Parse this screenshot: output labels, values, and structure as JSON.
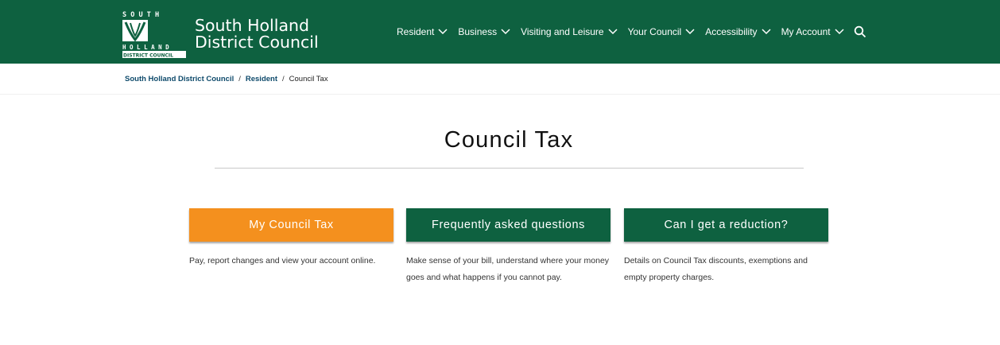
{
  "header": {
    "bg_color": "#0e6140",
    "logo": {
      "line1": "South Holland",
      "line2": "District Council",
      "mark_top": "S O U T H",
      "mark_mid": "H O L L A N D",
      "mark_bottom": "DISTRICT COUNCIL"
    },
    "nav": [
      {
        "label": "Resident",
        "icon": "chevron-down-icon"
      },
      {
        "label": "Business",
        "icon": "chevron-down-icon"
      },
      {
        "label": "Visiting and Leisure",
        "icon": "chevron-down-icon"
      },
      {
        "label": "Your Council",
        "icon": "chevron-down-icon"
      },
      {
        "label": "Accessibility",
        "icon": "chevron-down-icon"
      },
      {
        "label": "My Account",
        "icon": "chevron-down-icon"
      }
    ],
    "search_icon": "search-icon"
  },
  "breadcrumb": {
    "items": [
      "South Holland District Council",
      "Resident",
      "Council Tax"
    ],
    "separator": "/"
  },
  "main": {
    "title": "Council Tax",
    "cards": [
      {
        "button": "My Council Tax",
        "color": "#f4901e",
        "description": "Pay, report changes and view your account online."
      },
      {
        "button": "Frequently asked questions",
        "color": "#0e6140",
        "description": "Make sense of your bill, understand where your money goes and what happens if you cannot pay."
      },
      {
        "button": "Can I get a reduction?",
        "color": "#0e6140",
        "description": "Details on Council Tax discounts, exemptions and empty property charges."
      }
    ]
  }
}
